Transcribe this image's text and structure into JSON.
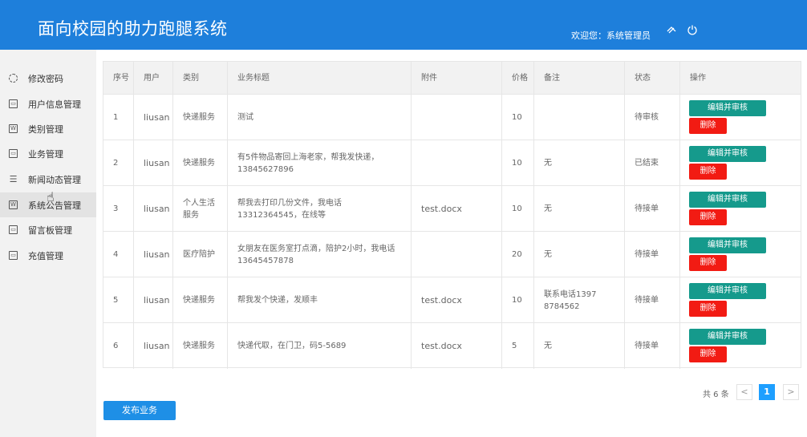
{
  "header": {
    "title": "面向校园的助力跑腿系统",
    "welcome": "欢迎您：系统管理员",
    "icons": [
      "theme-icon",
      "power-icon"
    ]
  },
  "sidebar": {
    "items": [
      {
        "label": "修改密码",
        "icon": "key-icon"
      },
      {
        "label": "用户信息管理",
        "icon": "image-icon"
      },
      {
        "label": "类别管理",
        "icon": "word-icon"
      },
      {
        "label": "业务管理",
        "icon": "image-icon"
      },
      {
        "label": "新闻动态管理",
        "icon": "list-icon"
      },
      {
        "label": "系统公告管理",
        "icon": "word-icon"
      },
      {
        "label": "留言板管理",
        "icon": "image-icon"
      },
      {
        "label": "充值管理",
        "icon": "image-icon"
      }
    ],
    "active_index": 5
  },
  "table": {
    "headers": [
      "序号",
      "用户",
      "类别",
      "业务标题",
      "附件",
      "价格",
      "备注",
      "状态",
      "操作"
    ],
    "rows": [
      {
        "no": "1",
        "user": "liusan",
        "category": "快递服务",
        "title": "测试",
        "attachment": "",
        "price": "10",
        "remark": "",
        "status": "待审核"
      },
      {
        "no": "2",
        "user": "liusan",
        "category": "快递服务",
        "title": "有5件物品寄回上海老家，帮我发快递，13845627896",
        "attachment": "",
        "price": "10",
        "remark": "无",
        "status": "已结束"
      },
      {
        "no": "3",
        "user": "liusan",
        "category": "个人生活服务",
        "title": "帮我去打印几份文件，我电话13312364545，在线等",
        "attachment": "test.docx",
        "price": "10",
        "remark": "无",
        "status": "待接单"
      },
      {
        "no": "4",
        "user": "liusan",
        "category": "医疗陪护",
        "title": "女朋友在医务室打点滴，陪护2小时，我电话13645457878",
        "attachment": "",
        "price": "20",
        "remark": "无",
        "status": "待接单"
      },
      {
        "no": "5",
        "user": "liusan",
        "category": "快递服务",
        "title": "帮我发个快递，发顺丰",
        "attachment": "test.docx",
        "price": "10",
        "remark": "联系电话13978784562",
        "status": "待接单"
      },
      {
        "no": "6",
        "user": "liusan",
        "category": "快递服务",
        "title": "快递代取，在门卫，码5-5689",
        "attachment": "test.docx",
        "price": "5",
        "remark": "无",
        "status": "待接单"
      }
    ],
    "edit_label": "编辑并审核",
    "delete_label": "删除"
  },
  "pagination": {
    "total_text": "共 6 条",
    "prev": "<",
    "current_page": "1",
    "next": ">"
  },
  "actions": {
    "publish_label": "发布业务"
  },
  "colors": {
    "header_bg": "#1E7FDB",
    "edit_btn": "#159A8C",
    "delete_btn": "#F21B13",
    "publish_btn": "#1E8FE6",
    "page_active": "#1E9FFF"
  }
}
